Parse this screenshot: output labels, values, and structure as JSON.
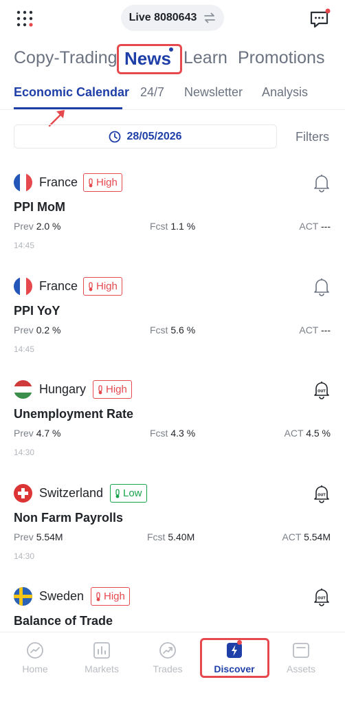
{
  "header": {
    "account_label": "Live 8080643"
  },
  "main_tabs": [
    {
      "label": "Copy-Trading"
    },
    {
      "label": "News"
    },
    {
      "label": "Learn"
    },
    {
      "label": "Promotions"
    }
  ],
  "sub_tabs": [
    {
      "label": "Economic Calendar"
    },
    {
      "label": "24/7"
    },
    {
      "label": "Newsletter"
    },
    {
      "label": "Analysis"
    }
  ],
  "calendar": {
    "date": "28/05/2026",
    "filters_label": "Filters"
  },
  "labels": {
    "prev": "Prev",
    "fcst": "Fcst",
    "act": "ACT"
  },
  "events": [
    {
      "country": "France",
      "impact": "High",
      "title": "PPI MoM",
      "prev": "2.0 %",
      "fcst": "1.1 %",
      "act": "---",
      "time": "14:45"
    },
    {
      "country": "France",
      "impact": "High",
      "title": "PPI YoY",
      "prev": "0.2 %",
      "fcst": "5.6 %",
      "act": "---",
      "time": "14:45"
    },
    {
      "country": "Hungary",
      "impact": "High",
      "title": "Unemployment Rate",
      "prev": "4.7 %",
      "fcst": "4.3 %",
      "act": "4.5 %",
      "time": "14:30"
    },
    {
      "country": "Switzerland",
      "impact": "Low",
      "title": "Non Farm Payrolls",
      "prev": "5.54M",
      "fcst": "5.40M",
      "act": "5.54M",
      "time": "14:30"
    },
    {
      "country": "Sweden",
      "impact": "High",
      "title": "Balance of Trade"
    }
  ],
  "bottom_nav": [
    {
      "label": "Home"
    },
    {
      "label": "Markets"
    },
    {
      "label": "Trades"
    },
    {
      "label": "Discover"
    },
    {
      "label": "Assets"
    }
  ],
  "colors": {
    "accent": "#1f3fa8",
    "high_impact": "#e5484d",
    "low_impact": "#16a34a",
    "annotation": "#e5484d"
  }
}
